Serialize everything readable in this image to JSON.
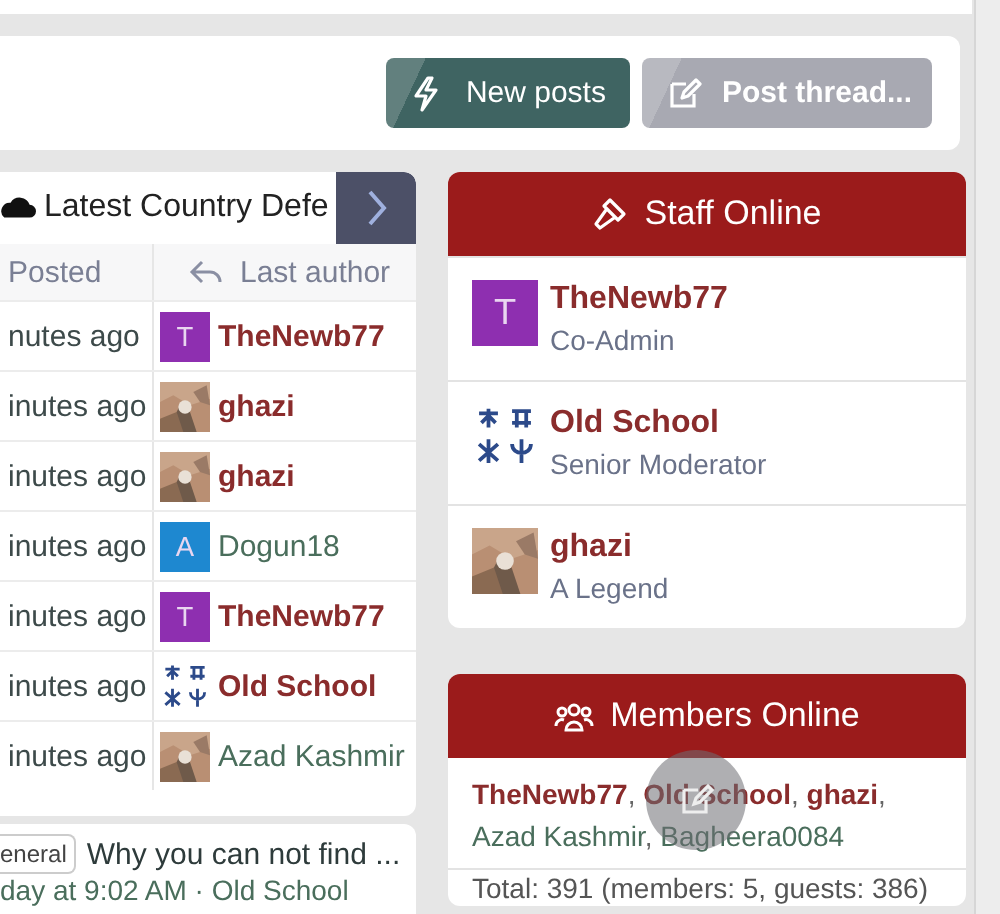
{
  "toolbar": {
    "buttons": [
      {
        "label": "New posts",
        "disabled": false
      },
      {
        "label": "Post thread...",
        "disabled": true
      }
    ]
  },
  "latest_threads": {
    "title": "Latest Country Defe",
    "columns": [
      "Posted",
      "Last author"
    ],
    "rows": [
      {
        "posted": "nutes ago",
        "author": "TheNewb77",
        "emphasized": true,
        "avatar": {
          "kind": "letter",
          "letter": "T",
          "color": "#8e2fb0"
        }
      },
      {
        "posted": "inutes ago",
        "author": "ghazi",
        "emphasized": true
      },
      {
        "posted": "inutes ago",
        "author": "ghazi",
        "emphasized": true
      },
      {
        "posted": "inutes ago",
        "author": "Dogun18",
        "emphasized": false,
        "avatar": {
          "kind": "letter",
          "letter": "A",
          "color": "#1e88d0"
        }
      },
      {
        "posted": "inutes ago",
        "author": "TheNewb77",
        "emphasized": true,
        "avatar": {
          "kind": "letter",
          "letter": "T",
          "color": "#8e2fb0"
        }
      },
      {
        "posted": "inutes ago",
        "author": "Old School",
        "emphasized": true,
        "avatar": {
          "kind": "emblem"
        }
      },
      {
        "posted": "inutes ago",
        "author": "Azad Kashmir",
        "emphasized": false
      }
    ]
  },
  "thread_preview": {
    "tag": "eneral",
    "title": "Why you can not find ...",
    "meta": "day at 9:02 AM · Old School"
  },
  "staff_online": {
    "title": "Staff Online",
    "members": [
      {
        "name": "TheNewb77",
        "role": "Co-Admin",
        "avatar": {
          "kind": "letter",
          "letter": "T",
          "color": "#8e2fb0"
        }
      },
      {
        "name": "Old School",
        "role": "Senior Moderator",
        "avatar": {
          "kind": "emblem"
        }
      },
      {
        "name": "ghazi",
        "role": "A Legend"
      }
    ]
  },
  "members_online": {
    "title": "Members Online",
    "members": [
      {
        "name": "TheNewb77",
        "emphasized": true,
        "separator": ","
      },
      {
        "name": "Old School",
        "emphasized": true,
        "separator": ","
      },
      {
        "name": "ghazi",
        "emphasized": true,
        "separator": ","
      },
      {
        "name": "Azad Kashmir",
        "emphasized": false,
        "separator": ","
      },
      {
        "name": "Bagheera0084",
        "emphasized": false
      }
    ],
    "total": "Total: 391 (members: 5, guests: 386)"
  }
}
